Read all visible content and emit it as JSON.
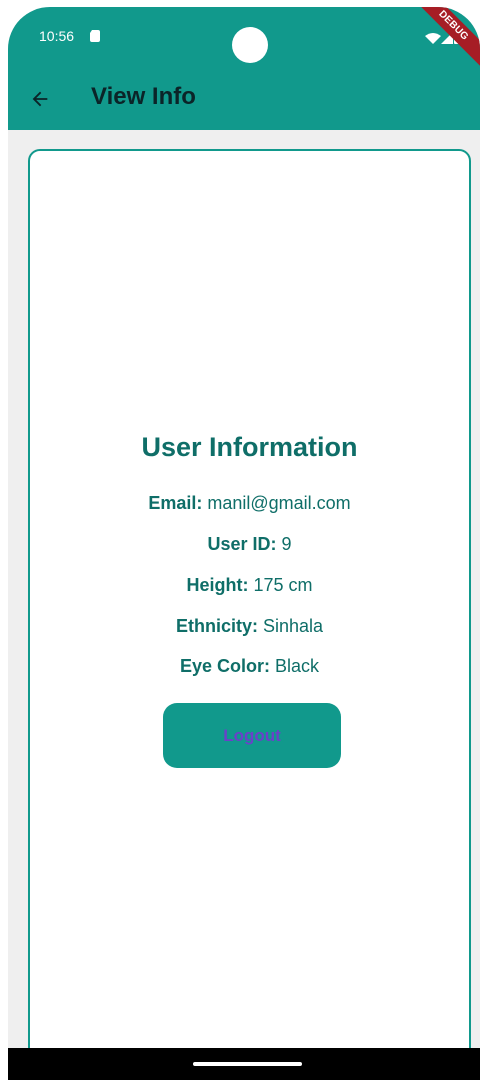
{
  "status_bar": {
    "time": "10:56"
  },
  "app_bar": {
    "title": "View Info",
    "back_icon": "arrow-back-icon"
  },
  "debug_banner": {
    "label": "DEBUG"
  },
  "card": {
    "title": "User Information",
    "rows": [
      {
        "label": "Email:",
        "value": "manil@gmail.com"
      },
      {
        "label": "User ID:",
        "value": "9"
      },
      {
        "label": "Height:",
        "value": "175 cm"
      },
      {
        "label": "Ethnicity:",
        "value": "Sinhala"
      },
      {
        "label": "Eye Color:",
        "value": "Black"
      }
    ]
  },
  "actions": {
    "logout_label": "Logout"
  },
  "colors": {
    "primary": "#11998c",
    "text_primary": "#0f6e68",
    "background": "#efefef",
    "logout_text": "#6a41c9"
  },
  "icons": {
    "sim": "sim-card-icon",
    "wifi": "wifi-icon",
    "signal": "signal-icon",
    "battery": "battery-icon"
  }
}
